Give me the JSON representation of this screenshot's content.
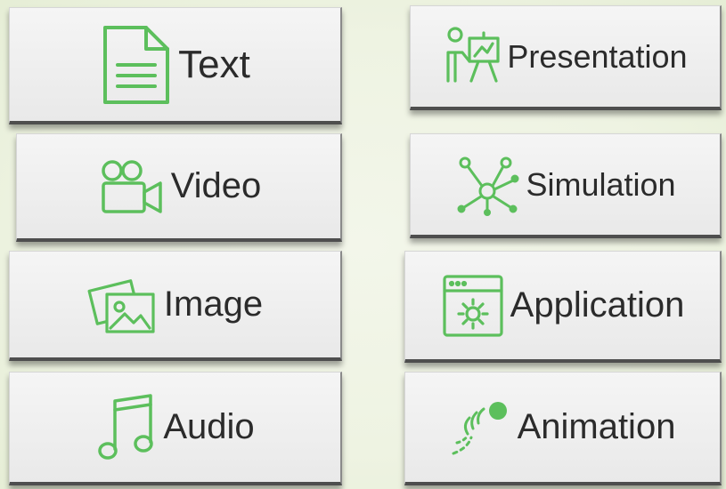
{
  "colors": {
    "accent": "#5cbf5c",
    "tile": "#eeeeee",
    "text": "#2b2b2b"
  },
  "buttons": [
    {
      "label": "Text",
      "icon": "document-icon"
    },
    {
      "label": "Presentation",
      "icon": "presenter-icon"
    },
    {
      "label": "Video",
      "icon": "video-camera-icon"
    },
    {
      "label": "Simulation",
      "icon": "network-icon"
    },
    {
      "label": "Image",
      "icon": "image-gallery-icon"
    },
    {
      "label": "Application",
      "icon": "app-window-gear-icon"
    },
    {
      "label": "Audio",
      "icon": "music-note-icon"
    },
    {
      "label": "Animation",
      "icon": "bouncing-ball-icon"
    }
  ]
}
